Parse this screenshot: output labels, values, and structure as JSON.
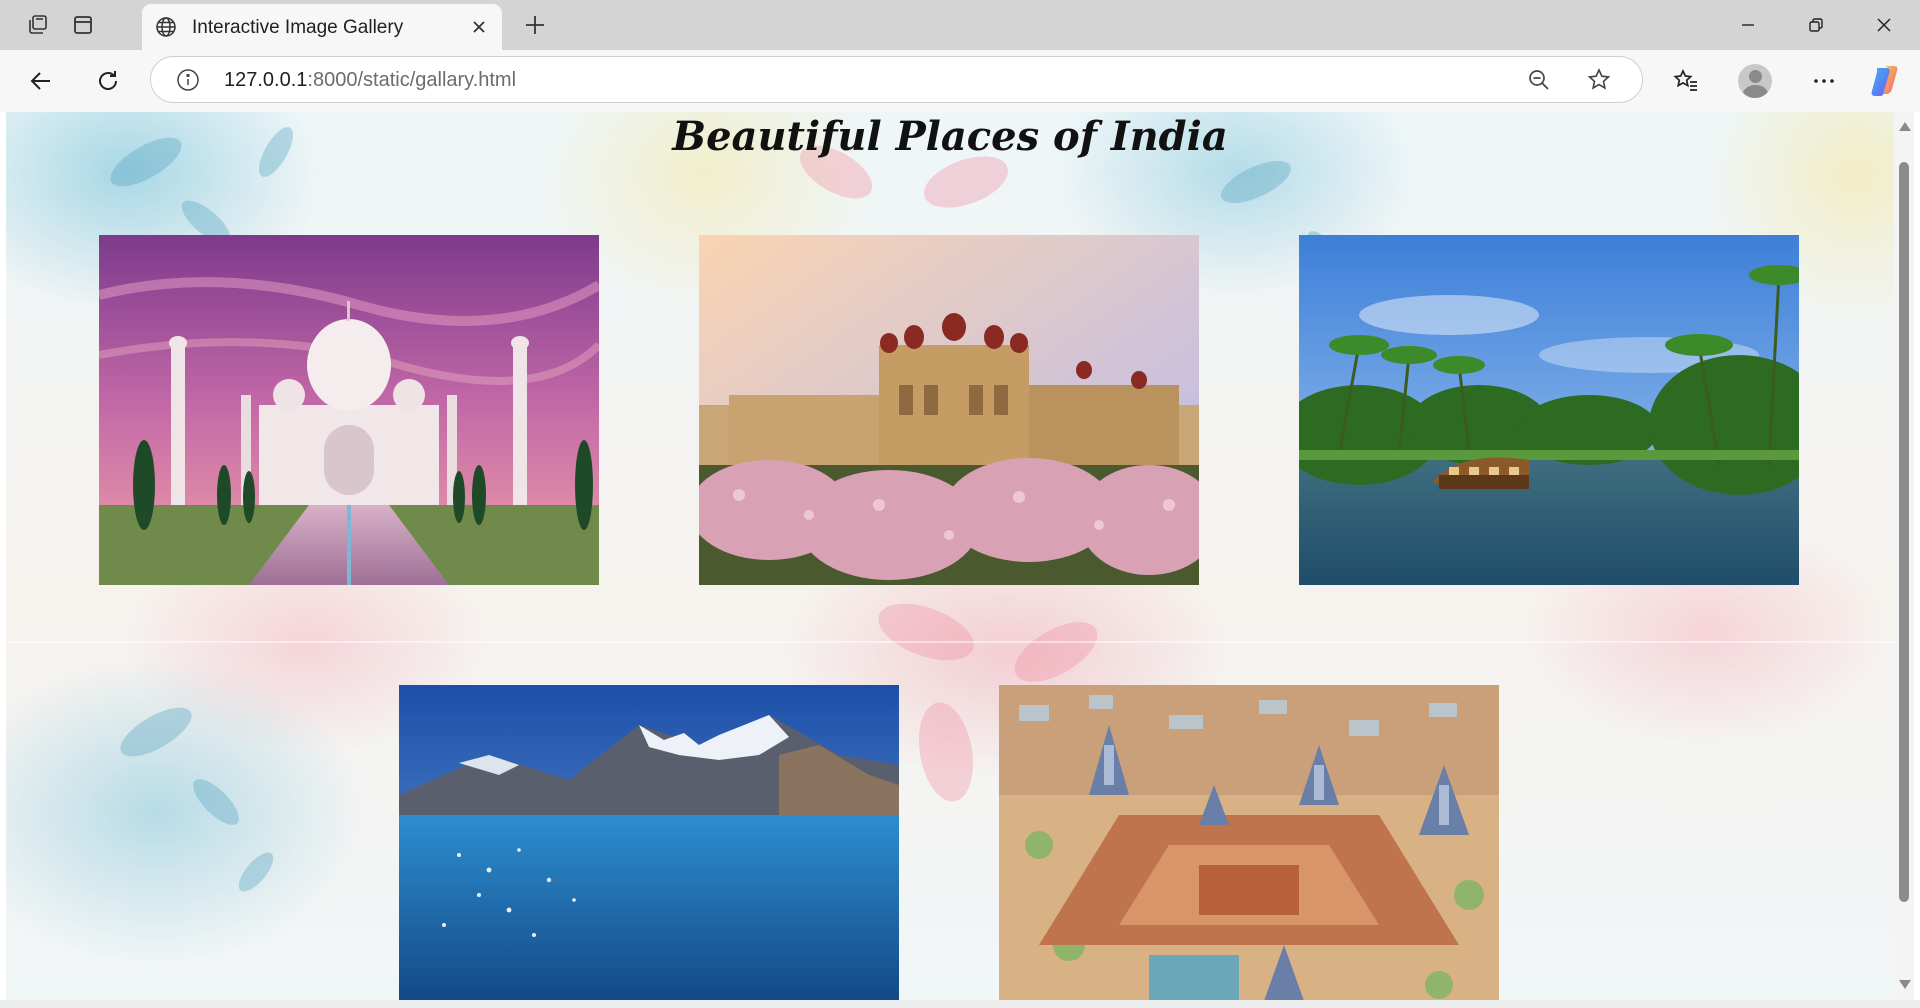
{
  "browser": {
    "tab": {
      "title": "Interactive Image Gallery",
      "icon": "globe-icon"
    },
    "new_tab_icon": "plus-icon",
    "window_controls": [
      "minimize-icon",
      "restore-icon",
      "close-icon"
    ],
    "address": {
      "host": "127.0.0.1",
      "rest": ":8000/static/gallary.html"
    },
    "toolbar_icons": [
      "back-arrow-icon",
      "reload-icon",
      "info-icon",
      "zoom-out-icon",
      "star-icon",
      "favorites-icon",
      "profile-avatar",
      "more-icon",
      "copilot-icon"
    ]
  },
  "page": {
    "title": "Beautiful Places of India",
    "images": [
      {
        "name": "taj-mahal-image",
        "subject": "Taj Mahal at sunset with reflecting pool"
      },
      {
        "name": "mysore-palace-image",
        "subject": "Mysore Palace with flowering shrubs"
      },
      {
        "name": "kerala-backwaters-image",
        "subject": "Houseboat on Kerala backwaters"
      },
      {
        "name": "mountain-lake-image",
        "subject": "Blue glacial lake with snowy mountains"
      },
      {
        "name": "temple-city-image",
        "subject": "Aerial view of temple complex"
      }
    ]
  },
  "colors": {
    "tabstrip": "#d4d4d4",
    "toolbar": "#f7f7f7",
    "scroll_thumb": "#8b8b8b"
  }
}
